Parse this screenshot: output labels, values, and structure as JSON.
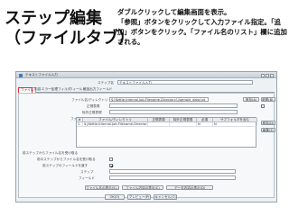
{
  "slide": {
    "title_line1": "ステップ編集",
    "title_line2": "（ファイルタブ）",
    "note_lines": [
      "ダブルクリックして編集画面を表示。",
      "「参照」ボタンをクリックして入力ファイル指定。「追",
      "加」ボタンをクリック。「ファイル名のリスト」欄に追加",
      "される。"
    ]
  },
  "dialog": {
    "title": "テキストファイル入力",
    "step_name_label": "ステップ名",
    "step_name_value": "テキストファイル入力",
    "tabs": [
      "ファイル",
      "内容",
      "エラー処理",
      "フィルタ",
      "フィールド",
      "追加出力フィールド"
    ],
    "file_or_dir_label": "ファイル名/ディレクトリ",
    "file_or_dir_value": "${Kettle.Internal.Job.Filename.Directory}/sample_data.txt",
    "add_button": "追加(A)",
    "browse_button": "参照(B)...",
    "regex_label": "正規表現",
    "exclude_regex_label": "除外正規表現",
    "selected_files_label": "ファイル名のリスト",
    "grid_headers": [
      "#",
      "ファイル/ディレクトリ",
      "正規表現",
      "除外正規表現",
      "必須",
      "サブフォルダを含む"
    ],
    "grid_row": {
      "index": "1",
      "file": "${Kettle.Internal.Job.Filename.Directory}/sample_data.txt",
      "required": "N",
      "subfolders": "N"
    },
    "delete_button": "削除(D)",
    "edit_button": "編集(E)",
    "from_prev_label": "前ステップからファイル名を受け取る",
    "prev_step_accept_label": "前のステップからファイル名を受け取る",
    "pass_through_label": "前ステップのフィールドを渡す",
    "step_to_read_label": "ステップ",
    "field_in_input_label": "フィールド",
    "show_filenames_button": "ファイル名の表示(S)...",
    "show_file_content_button": "ファイル内容の表示(C)",
    "show_data_content_button": "データ内容の表示(D)",
    "ok_button": "OK(O)",
    "preview_button": "プレビュー(P)",
    "cancel_button": "キャンセル(C)"
  }
}
